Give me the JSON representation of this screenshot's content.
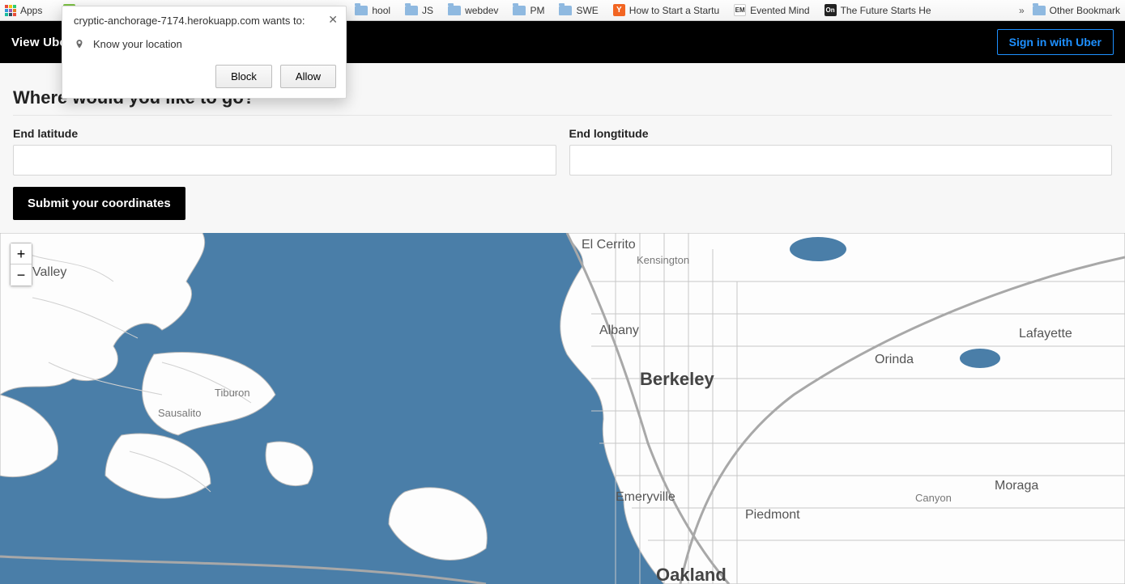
{
  "bookmarks_bar": {
    "apps_label": "Apps",
    "items": [
      {
        "label": "hool",
        "icon": "folder"
      },
      {
        "label": "JS",
        "icon": "folder"
      },
      {
        "label": "webdev",
        "icon": "folder"
      },
      {
        "label": "PM",
        "icon": "folder"
      },
      {
        "label": "SWE",
        "icon": "folder"
      },
      {
        "label": "How to Start a Startu",
        "icon": "yc"
      },
      {
        "label": "Evented Mind",
        "icon": "em"
      },
      {
        "label": "The Future Starts He",
        "icon": "on"
      }
    ],
    "overflow_glyph": "»",
    "other_bookmarks_label": "Other Bookmark"
  },
  "permission_popup": {
    "origin_wants_to": "cryptic-anchorage-7174.herokuapp.com wants to:",
    "permission_text": "Know your location",
    "block_label": "Block",
    "allow_label": "Allow",
    "close_glyph": "✕"
  },
  "header": {
    "brand": "View Uber",
    "signin_label": "Sign in with Uber"
  },
  "form": {
    "heading": "Where would you like to go?",
    "end_lat_label": "End latitude",
    "end_lng_label": "End longtitude",
    "end_lat_value": "",
    "end_lng_value": "",
    "submit_label": "Submit your coordinates"
  },
  "map": {
    "zoom_in_glyph": "+",
    "zoom_out_glyph": "−",
    "labels": {
      "valley": "Valley",
      "tiburon": "Tiburon",
      "sausalito": "Sausalito",
      "el_cerrito": "El Cerrito",
      "kensington": "Kensington",
      "albany": "Albany",
      "berkeley": "Berkeley",
      "emeryville": "Emeryville",
      "piedmont": "Piedmont",
      "oakland": "Oakland",
      "orinda": "Orinda",
      "lafayette": "Lafayette",
      "canyon": "Canyon",
      "moraga": "Moraga"
    }
  }
}
